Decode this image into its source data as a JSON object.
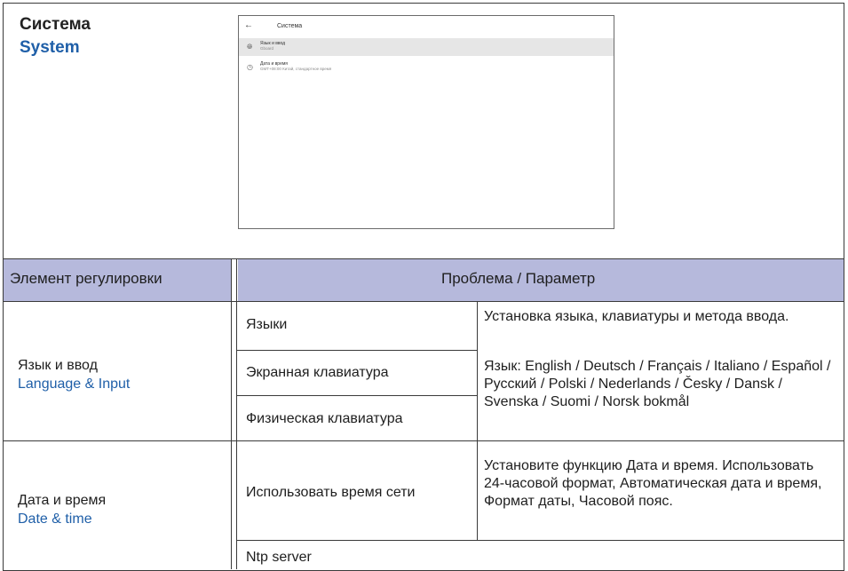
{
  "section": {
    "title_ru": "Система",
    "title_en": "System"
  },
  "screenshot": {
    "back_icon": "arrow-back-icon",
    "title": "Система",
    "items": [
      {
        "icon": "globe-icon",
        "label": "Язык и ввод",
        "sublabel": "Gboard"
      },
      {
        "icon": "clock-icon",
        "label": "Дата и время",
        "sublabel": "GMT+08:00 Китай, стандартное время"
      }
    ]
  },
  "table": {
    "header_left": "Элемент регулировки",
    "header_right": "Проблема / Параметр",
    "header_color": "#b6b9dc",
    "rows": [
      {
        "item_ru": "Язык и ввод",
        "item_en": "Language & Input",
        "options": [
          "Языки",
          "Экранная клавиатура",
          "Физическая клавиатура"
        ],
        "desc_1": "Установка языка, клавиатуры и метода ввода.",
        "desc_2": "Язык: English / Deutsch / Français / Italiano / Español / Русский / Polski / Nederlands / Česky / Dansk / Svenska / Suomi / Norsk bokmål"
      },
      {
        "item_ru": "Дата и время",
        "item_en": "Date & time",
        "options": [
          "Использовать время сети",
          "Ntp server"
        ],
        "desc_1": "Установите функцию Дата и время. Использовать 24-часовой формат, Автоматическая дата и время, Формат даты, Часовой пояс."
      }
    ]
  }
}
